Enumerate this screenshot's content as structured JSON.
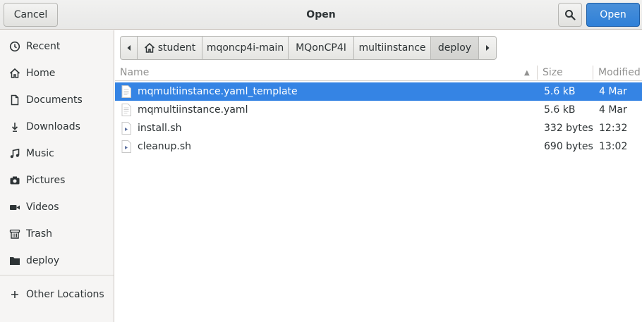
{
  "header": {
    "title": "Open",
    "cancel_label": "Cancel",
    "open_label": "Open",
    "search_icon": "search-icon"
  },
  "sidebar": {
    "items": [
      {
        "label": "Recent",
        "icon": "clock-icon"
      },
      {
        "label": "Home",
        "icon": "home-icon"
      },
      {
        "label": "Documents",
        "icon": "document-icon"
      },
      {
        "label": "Downloads",
        "icon": "download-icon"
      },
      {
        "label": "Music",
        "icon": "music-icon"
      },
      {
        "label": "Pictures",
        "icon": "camera-icon"
      },
      {
        "label": "Videos",
        "icon": "video-icon"
      },
      {
        "label": "Trash",
        "icon": "trash-icon"
      },
      {
        "label": "deploy",
        "icon": "folder-icon"
      }
    ],
    "other_locations": {
      "label": "Other Locations",
      "icon": "plus-icon"
    }
  },
  "pathbar": {
    "crumbs": [
      "student",
      "mqoncp4i-main",
      "MQonCP4I",
      "multiinstance",
      "deploy"
    ],
    "active": "deploy"
  },
  "columns": {
    "name": "Name",
    "size": "Size",
    "modified": "Modified",
    "sort_indicator": "▲"
  },
  "files": [
    {
      "name": "mqmultiinstance.yaml_template",
      "size": "5.6 kB",
      "modified": "4 Mar",
      "selected": true,
      "icon": "text-file-icon"
    },
    {
      "name": "mqmultiinstance.yaml",
      "size": "5.6 kB",
      "modified": "4 Mar",
      "selected": false,
      "icon": "text-file-icon"
    },
    {
      "name": "install.sh",
      "size": "332 bytes",
      "modified": "12:32",
      "selected": false,
      "icon": "script-file-icon"
    },
    {
      "name": "cleanup.sh",
      "size": "690 bytes",
      "modified": "13:02",
      "selected": false,
      "icon": "script-file-icon"
    }
  ],
  "colors": {
    "accent": "#3584e4",
    "open_button": "#2f80d8"
  }
}
